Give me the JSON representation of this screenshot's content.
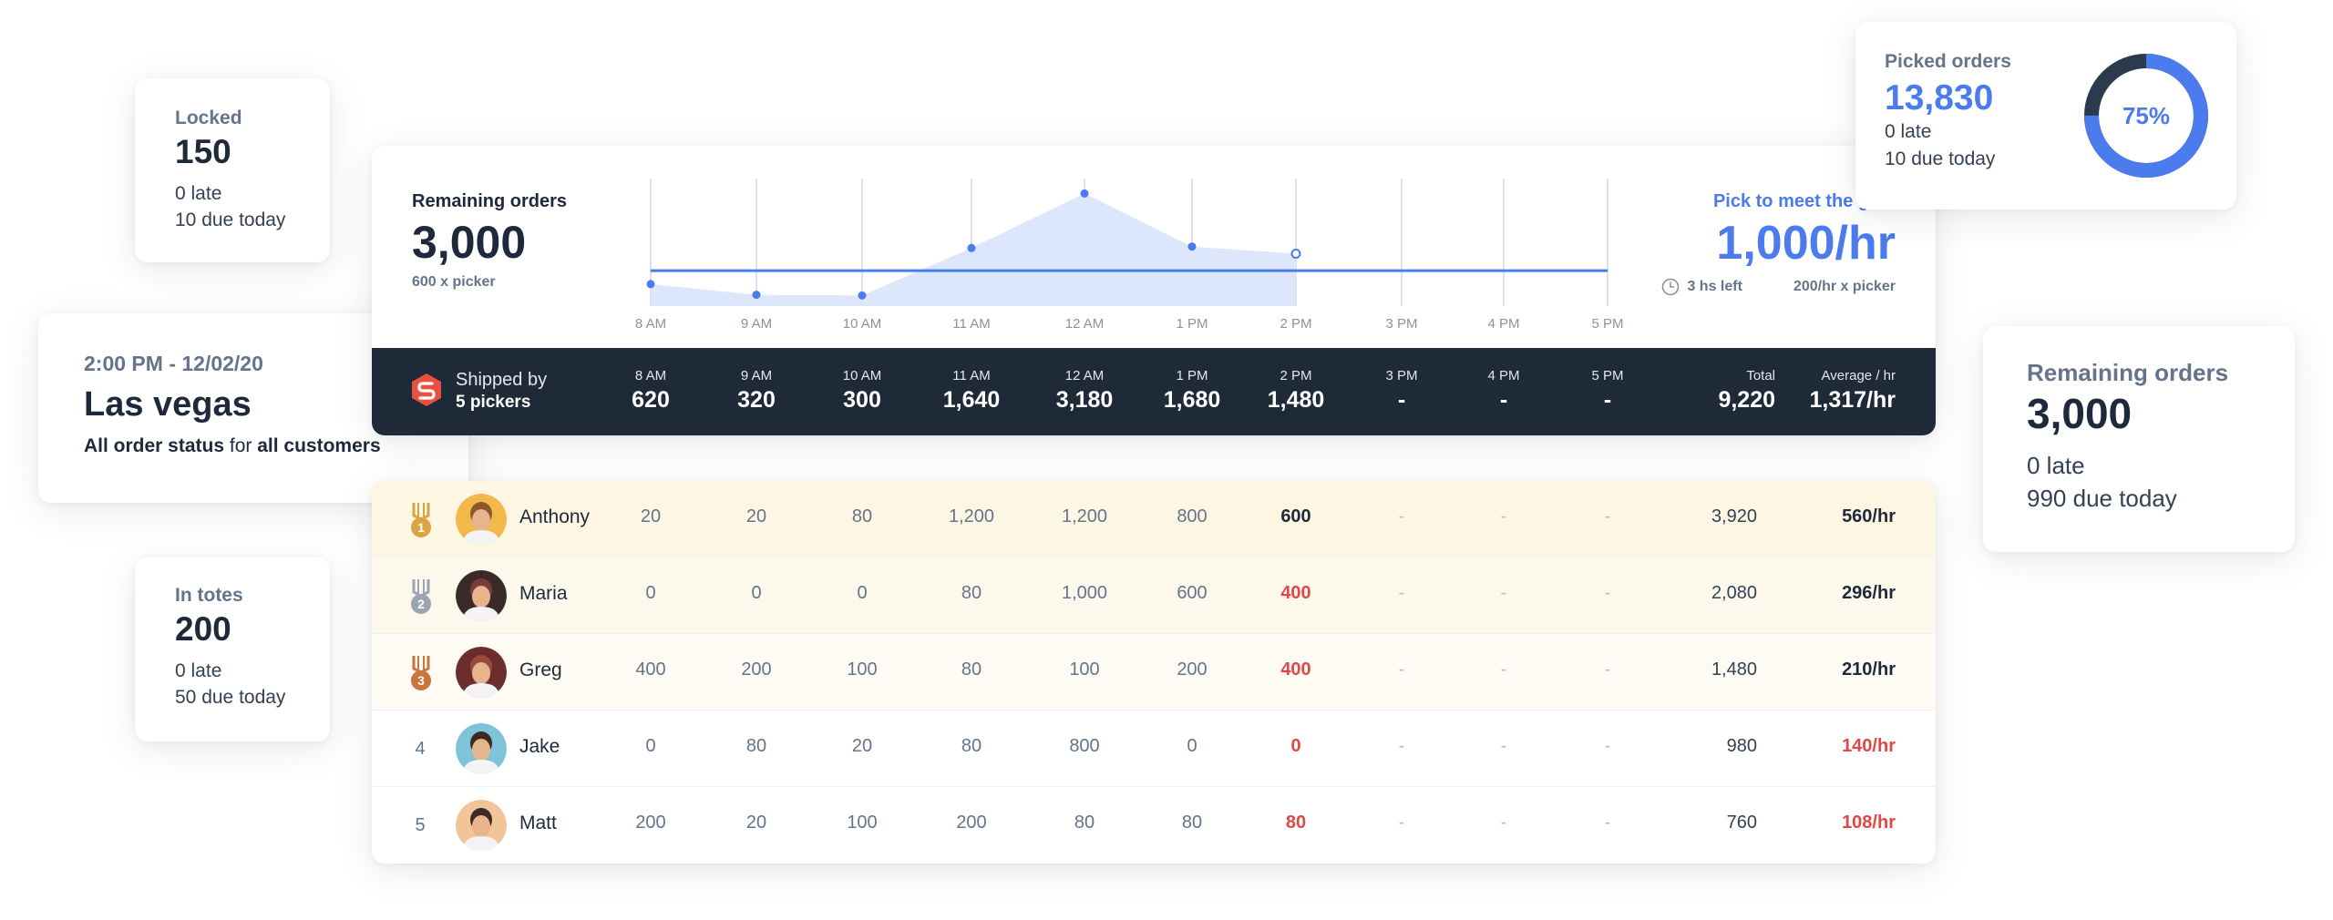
{
  "locked": {
    "title": "Locked",
    "value": "150",
    "late": "0 late",
    "due": "10 due today"
  },
  "in_totes": {
    "title": "In totes",
    "value": "200",
    "late": "0 late",
    "due": "50 due today"
  },
  "location": {
    "time": "2:00 PM - 12/02/20",
    "city": "Las vegas",
    "sub_a": "All order status",
    "sub_b": " for ",
    "sub_c": "all customers"
  },
  "picked": {
    "title": "Picked orders",
    "value": "13,830",
    "late": "0 late",
    "due": "10 due today",
    "percent_label": "75%",
    "percent": 0.75
  },
  "remaining_right": {
    "title": "Remaining orders",
    "value": "3,000",
    "late": "0 late",
    "due": "990 due today"
  },
  "panel": {
    "remaining_label": "Remaining orders",
    "remaining_value": "3,000",
    "per_picker": "600 x picker",
    "goal_label": "Pick to meet the goal",
    "goal_value": "1,000/hr",
    "time_left": "3 hs left",
    "goal_per_picker": "200/hr x picker"
  },
  "chart_data": {
    "type": "area",
    "categories": [
      "8 AM",
      "9 AM",
      "10 AM",
      "11 AM",
      "12 AM",
      "1 PM",
      "2 PM",
      "3 PM",
      "4 PM",
      "5 PM"
    ],
    "values": [
      620,
      320,
      300,
      1640,
      3180,
      1680,
      1480
    ],
    "goal": 1000,
    "ylim": [
      0,
      3500
    ],
    "colors": {
      "line": "#4b7bec",
      "fill": "#dde7fb",
      "grid": "#c9ced6"
    }
  },
  "summary": {
    "shipped_by": "Shipped by",
    "pickers": "5 pickers",
    "hours": [
      {
        "h": "8 AM",
        "v": "620"
      },
      {
        "h": "9 AM",
        "v": "320"
      },
      {
        "h": "10 AM",
        "v": "300"
      },
      {
        "h": "11 AM",
        "v": "1,640"
      },
      {
        "h": "12 AM",
        "v": "3,180"
      },
      {
        "h": "1 PM",
        "v": "1,680"
      },
      {
        "h": "2 PM",
        "v": "1,480"
      },
      {
        "h": "3 PM",
        "v": "-"
      },
      {
        "h": "4 PM",
        "v": "-"
      },
      {
        "h": "5 PM",
        "v": "-"
      }
    ],
    "total_label": "Total",
    "total_value": "9,220",
    "avg_label": "Average / hr",
    "avg_value": "1,317/hr"
  },
  "pickers": [
    {
      "rank": "1",
      "name": "Anthony",
      "values": [
        "20",
        "20",
        "80",
        "1,200",
        "1,200",
        "800",
        "600",
        "-",
        "-",
        "-"
      ],
      "total": "3,920",
      "avg": "560/hr",
      "current_red": false,
      "avg_red": false
    },
    {
      "rank": "2",
      "name": "Maria",
      "values": [
        "0",
        "0",
        "0",
        "80",
        "1,000",
        "600",
        "400",
        "-",
        "-",
        "-"
      ],
      "total": "2,080",
      "avg": "296/hr",
      "current_red": true,
      "avg_red": false
    },
    {
      "rank": "3",
      "name": "Greg",
      "values": [
        "400",
        "200",
        "100",
        "80",
        "100",
        "200",
        "400",
        "-",
        "-",
        "-"
      ],
      "total": "1,480",
      "avg": "210/hr",
      "current_red": true,
      "avg_red": false
    },
    {
      "rank": "4",
      "name": "Jake",
      "values": [
        "0",
        "80",
        "20",
        "80",
        "800",
        "0",
        "0",
        "-",
        "-",
        "-"
      ],
      "total": "980",
      "avg": "140/hr",
      "current_red": true,
      "avg_red": true
    },
    {
      "rank": "5",
      "name": "Matt",
      "values": [
        "200",
        "20",
        "100",
        "200",
        "80",
        "80",
        "80",
        "-",
        "-",
        "-"
      ],
      "total": "760",
      "avg": "108/hr",
      "current_red": true,
      "avg_red": true
    }
  ],
  "colors": {
    "accent": "#4b7bec",
    "dark": "#1e2a38",
    "red": "#e04848",
    "gold": "#d9a441",
    "silver": "#9aa4b2",
    "bronze": "#c8763b"
  }
}
